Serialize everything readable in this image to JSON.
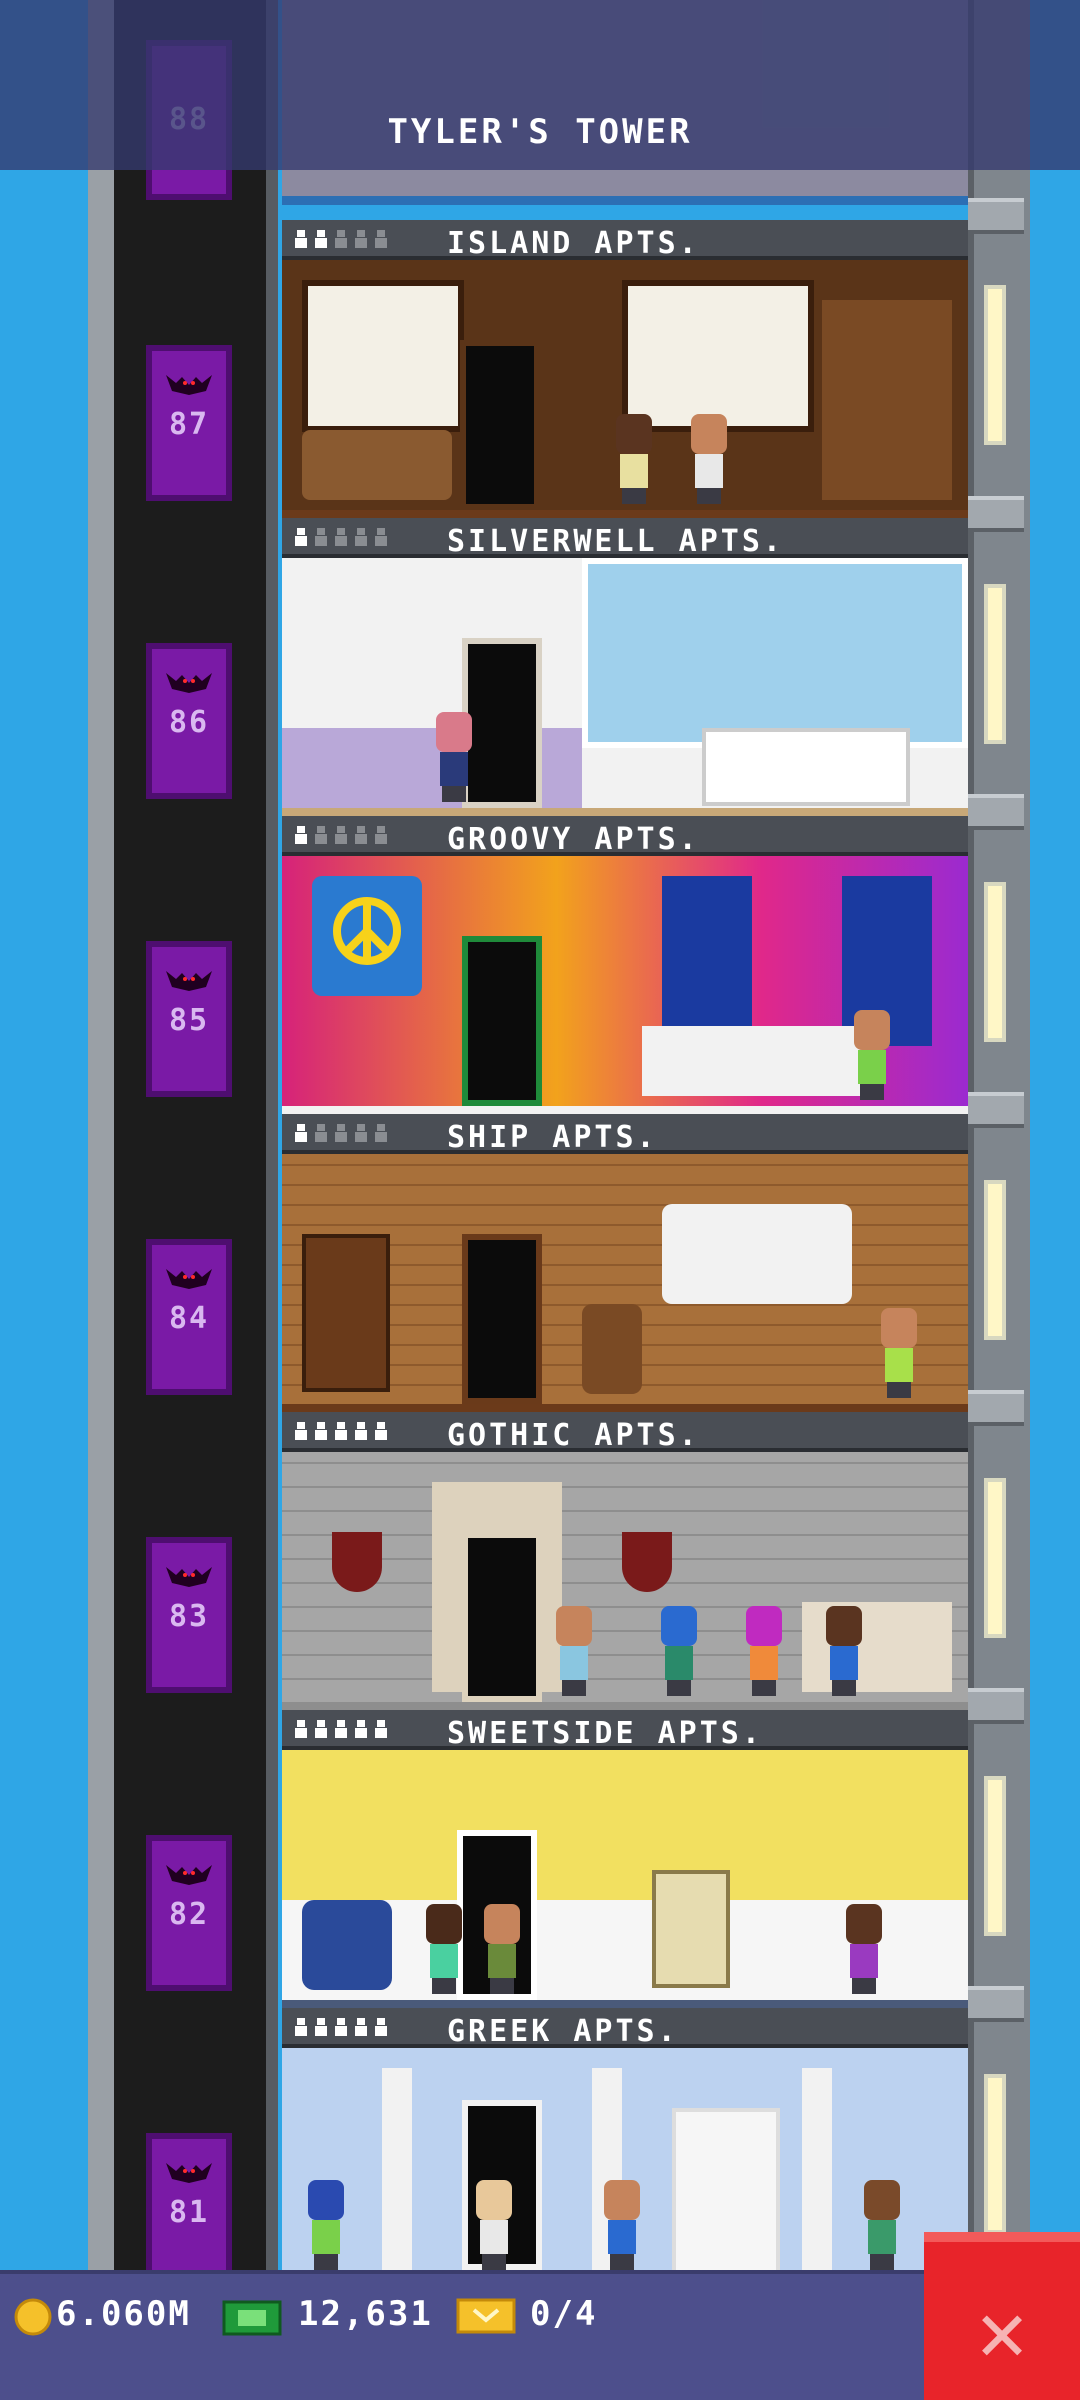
{
  "tower": {
    "title": "TYLER'S TOWER"
  },
  "floors": [
    {
      "label": "ISLAND APTS.",
      "number": "87",
      "residents": 2,
      "capacity": 5
    },
    {
      "label": "SILVERWELL APTS.",
      "number": "86",
      "residents": 1,
      "capacity": 5
    },
    {
      "label": "GROOVY APTS.",
      "number": "85",
      "residents": 1,
      "capacity": 5
    },
    {
      "label": "SHIP APTS.",
      "number": "84",
      "residents": 1,
      "capacity": 5
    },
    {
      "label": "GOTHIC APTS.",
      "number": "83",
      "residents": 5,
      "capacity": 5
    },
    {
      "label": "SWEETSIDE APTS.",
      "number": "82",
      "residents": 5,
      "capacity": 5
    },
    {
      "label": "GREEK APTS.",
      "number": "81",
      "residents": 5,
      "capacity": 5
    }
  ],
  "top_floor_number": "88",
  "stats": {
    "coins": "6.060M",
    "bux": "12,631",
    "tickets": "0/4"
  },
  "icons": {
    "coin": "coin-icon",
    "bux": "bux-icon",
    "ticket": "ticket-icon",
    "close": "close-icon",
    "resident": "resident-icon",
    "bat": "bat-icon"
  },
  "colors": {
    "sky": "#2fa6e6",
    "elevator_car": "#7a1aa6",
    "header_bar": "#4d4f8c",
    "close_button": "#e8242a"
  }
}
